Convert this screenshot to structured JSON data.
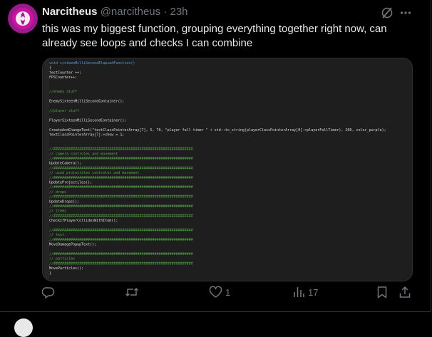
{
  "tweet": {
    "display_name": "Narcitheus",
    "handle": "@narcitheus",
    "separator": "·",
    "time": "23h",
    "text": "this was my biggest function, grouping everything together right now, can already see loops and checks I can combine",
    "grok_icon": "grok-icon",
    "more_icon": "more-icon"
  },
  "code": {
    "lines": [
      "void sixteenMilliSecondElapsedFunction()",
      "{",
      "    testCounter ++;",
      "    FPSCounter++;",
      "",
      "",
      "    //enemy stuff",
      "",
      "    EnemySixteenMilliSecondContainer();",
      "",
      "    //player stuff",
      "",
      "    PlayerSixteenMilliSecondContainer();",
      "",
      "    CreateAndChangeText(\"textClassPointerArray[7], 5, 70, \"player fall timer \" + std::to_string(playerClassPointerArray[0]->playerFallTimer), 200, color_purple);",
      "    textClassPointerArray[7]->show = 1;",
      "",
      "",
      "//#################################################################",
      "//                  camera controles and movement",
      "//#################################################################",
      "    UpdateCamera();",
      "//#################################################################",
      "//                  used projectiles controles and movement",
      "//#################################################################",
      "    UpdateProjectiles();",
      "//#################################################################",
      "//                  drops",
      "//#################################################################",
      "    UpdateDrops();",
      "//#################################################################",
      "//                  items",
      "//#################################################################",
      "    CheckIfPlayerCollidesWithItem();",
      "",
      "//#################################################################",
      "//                  text",
      "//#################################################################",
      "    MoveDamagePopupText();",
      "",
      "//#################################################################",
      "//                  particles",
      "//#################################################################",
      "    MoveParticles();",
      "}"
    ]
  },
  "actions": {
    "reply_icon": "reply-icon",
    "retweet_icon": "retweet-icon",
    "like_icon": "heart-icon",
    "like_count": "1",
    "views_icon": "views-icon",
    "views_count": "17",
    "bookmark_icon": "bookmark-icon",
    "share_icon": "share-icon"
  },
  "colors": {
    "background": "#000000",
    "text": "#e7e9ea",
    "muted": "#71767b",
    "code_bg": "#1e1e1e",
    "code_comment": "#57a64a",
    "code_text": "#dcdcdc",
    "code_keyword": "#569cd6",
    "code_string": "#d69d85",
    "avatar_purple": "#9b1b8e"
  }
}
